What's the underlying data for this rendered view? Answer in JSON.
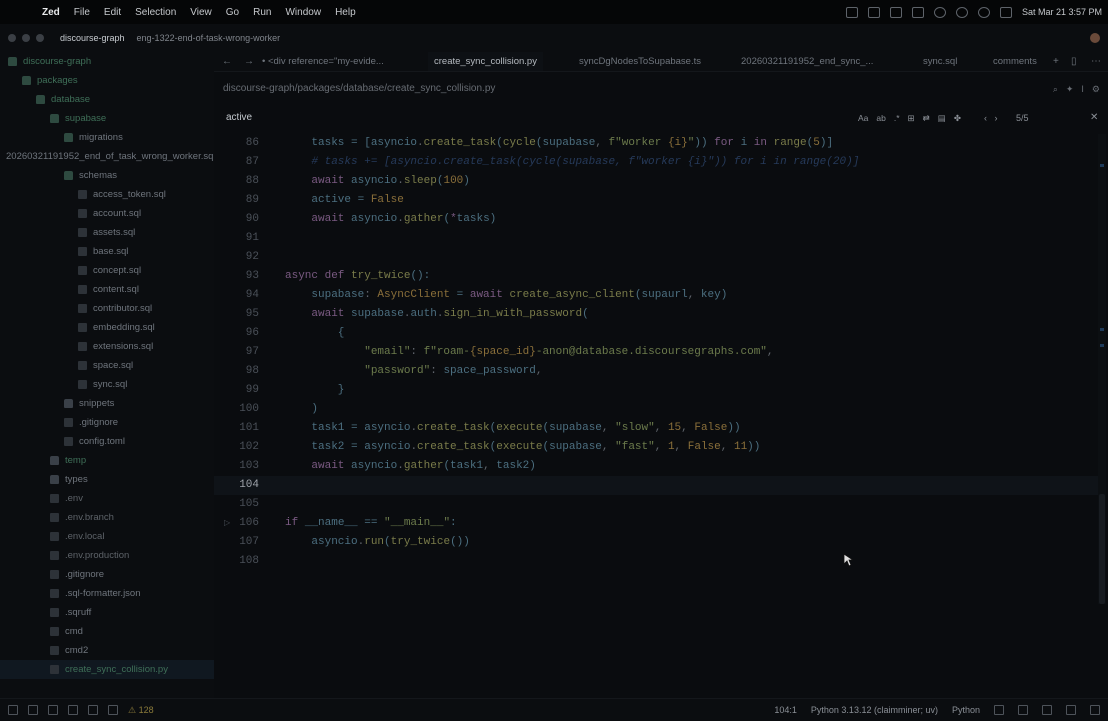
{
  "menubar": {
    "app_name": "Zed",
    "items": [
      "File",
      "Edit",
      "Selection",
      "View",
      "Go",
      "Run",
      "Window",
      "Help"
    ],
    "datetime": "Sat Mar 21  3:57 PM"
  },
  "titlebar": {
    "project": "discourse-graph",
    "branch": "eng-1322-end-of-task-wrong-worker"
  },
  "sidebar": {
    "items": [
      {
        "label": "discourse-graph",
        "depth": 0,
        "kind": "folder-open",
        "style": "green"
      },
      {
        "label": "packages",
        "depth": 1,
        "kind": "folder-open",
        "style": "green"
      },
      {
        "label": "database",
        "depth": 2,
        "kind": "folder-open",
        "style": "green"
      },
      {
        "label": "supabase",
        "depth": 3,
        "kind": "folder-open",
        "style": "green"
      },
      {
        "label": "migrations",
        "depth": 4,
        "kind": "folder-open",
        "style": "normal"
      },
      {
        "label": "20260321191952_end_of_task_wrong_worker.sql",
        "depth": 5,
        "kind": "file",
        "style": "normal"
      },
      {
        "label": "schemas",
        "depth": 4,
        "kind": "folder-open",
        "style": "normal"
      },
      {
        "label": "access_token.sql",
        "depth": 5,
        "kind": "file",
        "style": "normal"
      },
      {
        "label": "account.sql",
        "depth": 5,
        "kind": "file",
        "style": "normal"
      },
      {
        "label": "assets.sql",
        "depth": 5,
        "kind": "file",
        "style": "normal"
      },
      {
        "label": "base.sql",
        "depth": 5,
        "kind": "file",
        "style": "normal"
      },
      {
        "label": "concept.sql",
        "depth": 5,
        "kind": "file",
        "style": "normal"
      },
      {
        "label": "content.sql",
        "depth": 5,
        "kind": "file",
        "style": "normal"
      },
      {
        "label": "contributor.sql",
        "depth": 5,
        "kind": "file",
        "style": "normal"
      },
      {
        "label": "embedding.sql",
        "depth": 5,
        "kind": "file",
        "style": "normal"
      },
      {
        "label": "extensions.sql",
        "depth": 5,
        "kind": "file",
        "style": "normal"
      },
      {
        "label": "space.sql",
        "depth": 5,
        "kind": "file",
        "style": "normal"
      },
      {
        "label": "sync.sql",
        "depth": 5,
        "kind": "file",
        "style": "normal"
      },
      {
        "label": "snippets",
        "depth": 4,
        "kind": "folder",
        "style": "normal"
      },
      {
        "label": ".gitignore",
        "depth": 4,
        "kind": "file",
        "style": "normal"
      },
      {
        "label": "config.toml",
        "depth": 4,
        "kind": "file",
        "style": "normal"
      },
      {
        "label": "temp",
        "depth": 3,
        "kind": "folder",
        "style": "green"
      },
      {
        "label": "types",
        "depth": 3,
        "kind": "folder",
        "style": "normal"
      },
      {
        "label": ".env",
        "depth": 3,
        "kind": "file",
        "style": "muted"
      },
      {
        "label": ".env.branch",
        "depth": 3,
        "kind": "file",
        "style": "muted"
      },
      {
        "label": ".env.local",
        "depth": 3,
        "kind": "file",
        "style": "muted"
      },
      {
        "label": ".env.production",
        "depth": 3,
        "kind": "file",
        "style": "muted"
      },
      {
        "label": ".gitignore",
        "depth": 3,
        "kind": "file",
        "style": "normal"
      },
      {
        "label": ".sql-formatter.json",
        "depth": 3,
        "kind": "file",
        "style": "normal"
      },
      {
        "label": ".sqruff",
        "depth": 3,
        "kind": "file",
        "style": "normal"
      },
      {
        "label": "cmd",
        "depth": 3,
        "kind": "file",
        "style": "normal"
      },
      {
        "label": "cmd2",
        "depth": 3,
        "kind": "file",
        "style": "normal"
      },
      {
        "label": "create_sync_collision.py",
        "depth": 3,
        "kind": "file",
        "style": "green",
        "selected": true
      }
    ]
  },
  "tabs": [
    {
      "label": "<div reference=\"my-evide...",
      "active": false
    },
    {
      "label": "create_sync_collision.py",
      "active": true
    },
    {
      "label": "syncDgNodesToSupabase.ts",
      "active": false
    },
    {
      "label": "20260321191952_end_sync_...",
      "active": false
    },
    {
      "label": "sync.sql",
      "active": false
    },
    {
      "label": "comments",
      "active": false
    }
  ],
  "breadcrumb": "discourse-graph/packages/database/create_sync_collision.py",
  "search": {
    "query": "active",
    "option_labels": [
      "Aa",
      "ab",
      ".*"
    ],
    "match_count": "5/5"
  },
  "editor": {
    "current_line": 104,
    "lines": [
      {
        "num": 86,
        "tokens": [
          [
            "    tasks = [",
            "t"
          ],
          [
            "asyncio",
            "t"
          ],
          [
            ".",
            "p"
          ],
          [
            "create_task",
            "f"
          ],
          [
            "(",
            "t"
          ],
          [
            "cycle",
            "f"
          ],
          [
            "(supabase",
            "t"
          ],
          [
            ", ",
            "p"
          ],
          [
            "f\"worker ",
            "s"
          ],
          [
            "{i}",
            "n"
          ],
          [
            "\"",
            "s"
          ],
          [
            "))",
            "t"
          ],
          [
            " for ",
            "k"
          ],
          [
            "i",
            "t"
          ],
          [
            " in ",
            "k"
          ],
          [
            "range",
            "f"
          ],
          [
            "(",
            "t"
          ],
          [
            "5",
            "n"
          ],
          [
            ")]",
            "t"
          ]
        ]
      },
      {
        "num": 87,
        "tokens": [
          [
            "    # tasks += [asyncio.create_task(cycle(supabase, f\"worker {i}\")) for i in range(20)]",
            "c"
          ]
        ]
      },
      {
        "num": 88,
        "tokens": [
          [
            "    await ",
            "k"
          ],
          [
            "asyncio",
            "t"
          ],
          [
            ".",
            "p"
          ],
          [
            "sleep",
            "f"
          ],
          [
            "(",
            "t"
          ],
          [
            "100",
            "n"
          ],
          [
            ")",
            "t"
          ]
        ]
      },
      {
        "num": 89,
        "tokens": [
          [
            "    active = ",
            "t"
          ],
          [
            "False",
            "n"
          ]
        ]
      },
      {
        "num": 90,
        "tokens": [
          [
            "    await ",
            "k"
          ],
          [
            "asyncio",
            "t"
          ],
          [
            ".",
            "p"
          ],
          [
            "gather",
            "f"
          ],
          [
            "(",
            "t"
          ],
          [
            "*",
            "k"
          ],
          [
            "tasks)",
            "t"
          ]
        ]
      },
      {
        "num": 91,
        "tokens": []
      },
      {
        "num": 92,
        "tokens": []
      },
      {
        "num": 93,
        "tokens": [
          [
            "async def ",
            "k"
          ],
          [
            "try_twice",
            "f"
          ],
          [
            "():",
            "t"
          ]
        ]
      },
      {
        "num": 94,
        "tokens": [
          [
            "    supabase",
            "t"
          ],
          [
            ": ",
            "p"
          ],
          [
            "AsyncClient",
            "n"
          ],
          [
            " = ",
            "t"
          ],
          [
            "await ",
            "k"
          ],
          [
            "create_async_client",
            "f"
          ],
          [
            "(supaurl",
            "t"
          ],
          [
            ", ",
            "p"
          ],
          [
            "key)",
            "t"
          ]
        ]
      },
      {
        "num": 95,
        "tokens": [
          [
            "    await ",
            "k"
          ],
          [
            "supabase",
            "t"
          ],
          [
            ".",
            "p"
          ],
          [
            "auth",
            "t"
          ],
          [
            ".",
            "p"
          ],
          [
            "sign_in_with_password",
            "f"
          ],
          [
            "(",
            "t"
          ]
        ]
      },
      {
        "num": 96,
        "tokens": [
          [
            "        {",
            "t"
          ]
        ]
      },
      {
        "num": 97,
        "tokens": [
          [
            "            \"email\"",
            "s"
          ],
          [
            ": ",
            "p"
          ],
          [
            "f\"roam-",
            "s"
          ],
          [
            "{space_id}",
            "n"
          ],
          [
            "-anon@database.discoursegraphs.com\"",
            "s"
          ],
          [
            ",",
            "p"
          ]
        ]
      },
      {
        "num": 98,
        "tokens": [
          [
            "            \"password\"",
            "s"
          ],
          [
            ": ",
            "p"
          ],
          [
            "space_password",
            "t"
          ],
          [
            ",",
            "p"
          ]
        ]
      },
      {
        "num": 99,
        "tokens": [
          [
            "        }",
            "t"
          ]
        ]
      },
      {
        "num": 100,
        "tokens": [
          [
            "    )",
            "t"
          ]
        ]
      },
      {
        "num": 101,
        "tokens": [
          [
            "    task1 = ",
            "t"
          ],
          [
            "asyncio",
            "t"
          ],
          [
            ".",
            "p"
          ],
          [
            "create_task",
            "f"
          ],
          [
            "(",
            "t"
          ],
          [
            "execute",
            "f"
          ],
          [
            "(supabase",
            "t"
          ],
          [
            ", ",
            "p"
          ],
          [
            "\"slow\"",
            "s"
          ],
          [
            ", ",
            "p"
          ],
          [
            "15",
            "n"
          ],
          [
            ", ",
            "p"
          ],
          [
            "False",
            "n"
          ],
          [
            "))",
            "t"
          ]
        ]
      },
      {
        "num": 102,
        "tokens": [
          [
            "    task2 = ",
            "t"
          ],
          [
            "asyncio",
            "t"
          ],
          [
            ".",
            "p"
          ],
          [
            "create_task",
            "f"
          ],
          [
            "(",
            "t"
          ],
          [
            "execute",
            "f"
          ],
          [
            "(supabase",
            "t"
          ],
          [
            ", ",
            "p"
          ],
          [
            "\"fast\"",
            "s"
          ],
          [
            ", ",
            "p"
          ],
          [
            "1",
            "n"
          ],
          [
            ", ",
            "p"
          ],
          [
            "False",
            "n"
          ],
          [
            ", ",
            "p"
          ],
          [
            "11",
            "n"
          ],
          [
            "))",
            "t"
          ]
        ]
      },
      {
        "num": 103,
        "tokens": [
          [
            "    await ",
            "k"
          ],
          [
            "asyncio",
            "t"
          ],
          [
            ".",
            "p"
          ],
          [
            "gather",
            "f"
          ],
          [
            "(task1",
            "t"
          ],
          [
            ", ",
            "p"
          ],
          [
            "task2)",
            "t"
          ]
        ]
      },
      {
        "num": 104,
        "tokens": []
      },
      {
        "num": 105,
        "tokens": []
      },
      {
        "num": 106,
        "tokens": [
          [
            "if ",
            "k"
          ],
          [
            "__name__",
            "t"
          ],
          [
            " == ",
            "t"
          ],
          [
            "\"__main__\"",
            "s"
          ],
          [
            ":",
            "t"
          ]
        ],
        "runnable": true
      },
      {
        "num": 107,
        "tokens": [
          [
            "    asyncio",
            "t"
          ],
          [
            ".",
            "p"
          ],
          [
            "run",
            "f"
          ],
          [
            "(",
            "t"
          ],
          [
            "try_twice",
            "f"
          ],
          [
            "())",
            "t"
          ]
        ]
      },
      {
        "num": 108,
        "tokens": []
      }
    ]
  },
  "statusbar": {
    "warning_count": "128",
    "cursor_position": "104:1",
    "interpreter": "Python 3.13.12 (claimminer; uv)",
    "language": "Python"
  },
  "colors": {
    "background": "#0a0c0f",
    "accent_green": "#3f6f58",
    "keyword": "#7a5a82",
    "string": "#6c7b4c",
    "number": "#8a6f3a"
  }
}
